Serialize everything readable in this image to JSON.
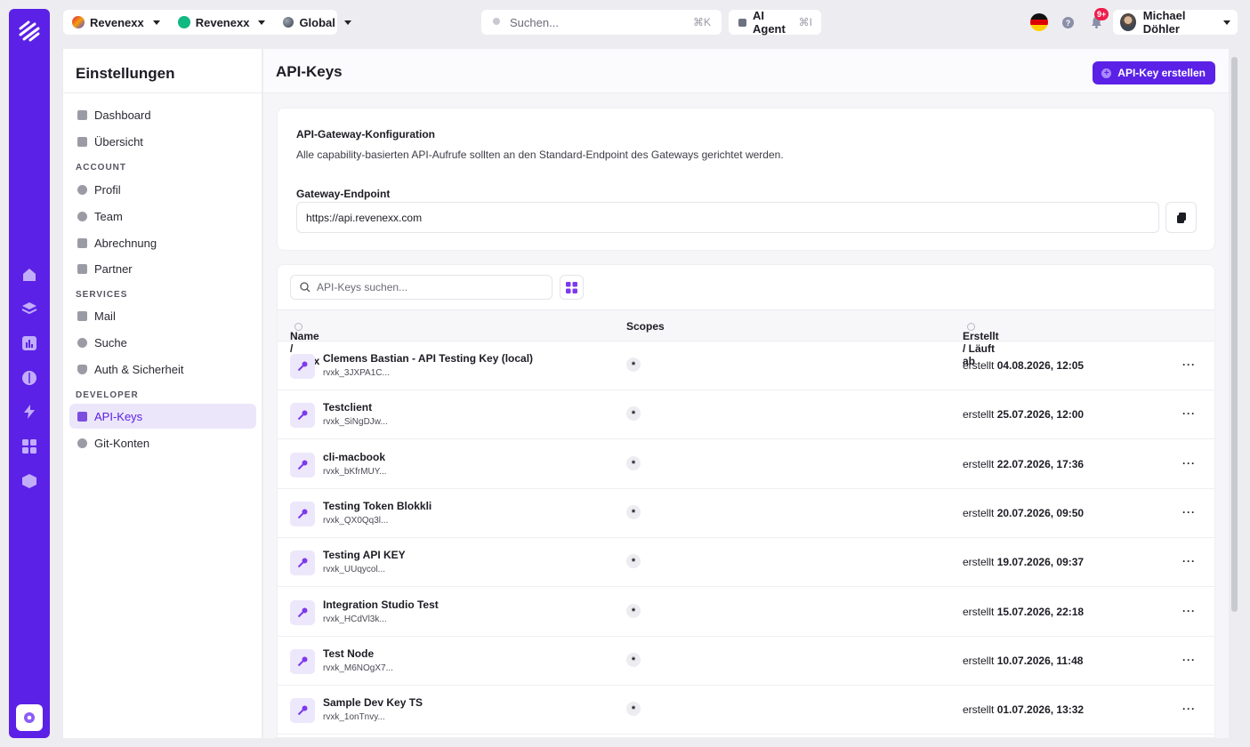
{
  "topbar": {
    "workspace1": "Revenexx",
    "workspace2": "Revenexx",
    "region": "Global",
    "search_placeholder": "Suchen...",
    "search_shortcut": "⌘K",
    "ai_label": "AI Agent",
    "ai_shortcut": "⌘I",
    "notification_badge": "9+",
    "user_name": "Michael Döhler"
  },
  "sidebar": {
    "title": "Einstellungen",
    "top_items": [
      "Dashboard",
      "Übersicht"
    ],
    "sections": [
      {
        "label": "ACCOUNT",
        "items": [
          "Profil",
          "Team",
          "Abrechnung",
          "Partner"
        ]
      },
      {
        "label": "SERVICES",
        "items": [
          "Mail",
          "Suche",
          "Auth & Sicherheit"
        ]
      },
      {
        "label": "DEVELOPER",
        "items": [
          "API-Keys",
          "Git-Konten"
        ]
      }
    ]
  },
  "page": {
    "title": "API-Keys",
    "create_button": "API-Key erstellen"
  },
  "gateway": {
    "heading": "API-Gateway-Konfiguration",
    "description": "Alle capability-basierten API-Aufrufe sollten an den Standard-Endpoint des Gateways gerichtet werden.",
    "endpoint_label": "Gateway-Endpoint",
    "endpoint_value": "https://api.revenexx.com"
  },
  "table": {
    "search_placeholder": "API-Keys suchen...",
    "columns": [
      "Name / Prefix",
      "Scopes",
      "Erstellt / Läuft ab"
    ],
    "created_prefix": "erstellt",
    "rows": [
      {
        "name": "Clemens Bastian - API Testing Key (local)",
        "prefix": "rvxk_3JXPA1C...",
        "scope": "*",
        "created": "04.08.2026, 12:05"
      },
      {
        "name": "Testclient",
        "prefix": "rvxk_SiNgDJw...",
        "scope": "*",
        "created": "25.07.2026, 12:00"
      },
      {
        "name": "cli-macbook",
        "prefix": "rvxk_bKfrMUY...",
        "scope": "*",
        "created": "22.07.2026, 17:36"
      },
      {
        "name": "Testing Token Blokkli",
        "prefix": "rvxk_QX0Qq3l...",
        "scope": "*",
        "created": "20.07.2026, 09:50"
      },
      {
        "name": "Testing API KEY",
        "prefix": "rvxk_UUqycol...",
        "scope": "*",
        "created": "19.07.2026, 09:37"
      },
      {
        "name": "Integration Studio Test",
        "prefix": "rvxk_HCdVl3k...",
        "scope": "*",
        "created": "15.07.2026, 22:18"
      },
      {
        "name": "Test Node",
        "prefix": "rvxk_M6NOgX7...",
        "scope": "*",
        "created": "10.07.2026, 11:48"
      },
      {
        "name": "Sample Dev Key TS",
        "prefix": "rvxk_1onTnvy...",
        "scope": "*",
        "created": "01.07.2026, 13:32"
      }
    ]
  },
  "colors": {
    "accent": "#5b21e6",
    "active_bg": "#ece6fb"
  }
}
